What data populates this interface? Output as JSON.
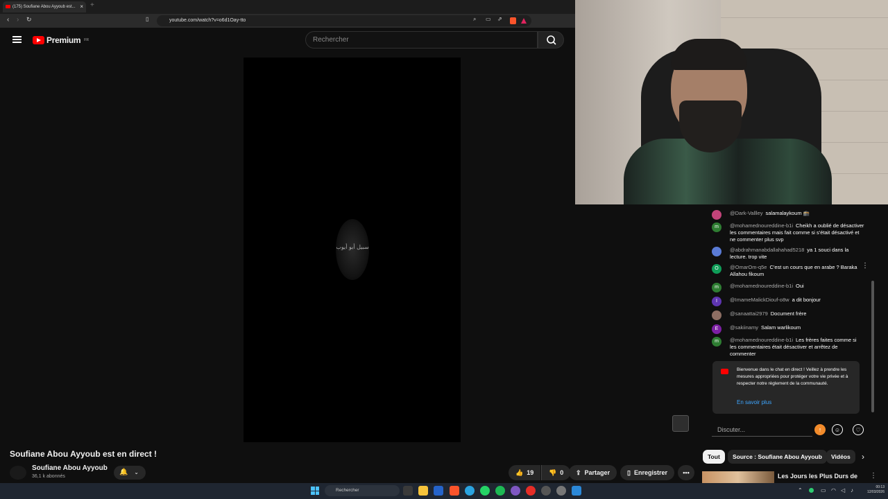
{
  "browser": {
    "tab_title": "(175) Soufiane Abou Ayyoub est...",
    "url": "youtube.com/watch?v=o6d1Oay-tto"
  },
  "header": {
    "logo_text": "Premium",
    "logo_region": "FR",
    "search_placeholder": "Rechercher"
  },
  "player": {
    "emblem_text": "سبيل أبو أيوب"
  },
  "video": {
    "title": "Soufiane Abou Ayyoub est en direct !",
    "channel_name": "Soufiane Abou Ayyoub",
    "subscribers": "36,1 k abonnés",
    "likes": "19",
    "dislikes": "0",
    "share_label": "Partager",
    "save_label": "Enregistrer"
  },
  "chat": {
    "messages": [
      {
        "user": "@Dark-Vallley",
        "text": "salamalaykoum 🕋",
        "avatar": "",
        "color": "#c2447a"
      },
      {
        "user": "@mohamednoureddine-b1i",
        "text": "Cheikh a oublié de désactiver les commentaires mais fait comme si s'était désactivé et ne commenter plus svp",
        "avatar": "m",
        "color": "#2e7d32"
      },
      {
        "user": "@abdrahmanabdallahahad5218",
        "text": "ya 1 souci dans la lecture. trop vite",
        "avatar": "",
        "color": "#5a7bd6"
      },
      {
        "user": "@OmarOm-q5e",
        "text": "C'est un cours que en arabe ? Baraka Allahou fikoum",
        "avatar": "O",
        "color": "#0f9d58"
      },
      {
        "user": "@mohamednoureddine-b1i",
        "text": "Oui",
        "avatar": "m",
        "color": "#2e7d32"
      },
      {
        "user": "@ImameMalickDiouf-o8w",
        "text": "a dit bonjour",
        "avatar": "I",
        "color": "#5e35b1"
      },
      {
        "user": "@sanaattai2979",
        "text": "Document frère",
        "avatar": "",
        "color": "#8d6e63"
      },
      {
        "user": "@sakiinamy",
        "text": "Salam warlikoum",
        "avatar": "E",
        "color": "#7b1fa2"
      },
      {
        "user": "@mohamednoureddine-b1i",
        "text": "Les frères faites comme si les commentaires était désactiver et arrêtez de commenter",
        "avatar": "m",
        "color": "#2e7d32"
      }
    ],
    "welcome_text": "Bienvenue dans le chat en direct ! Veillez à prendre les mesures appropriées pour protéger votre vie privée et à respecter notre règlement de la communauté.",
    "learn_more": "En savoir plus",
    "input_placeholder": "Discuter..."
  },
  "related": {
    "chips": [
      "Tout",
      "Source : Soufiane Abou Ayyoub",
      "Vidéos"
    ],
    "first_title": "Les Jours les Plus Durs de"
  },
  "taskbar": {
    "search_placeholder": "Rechercher",
    "time": "00:13",
    "date": "12/03/2026"
  },
  "colors": {
    "brand_red": "#ff0000",
    "link_blue": "#3ea6ff",
    "background": "#0f0f0f"
  }
}
